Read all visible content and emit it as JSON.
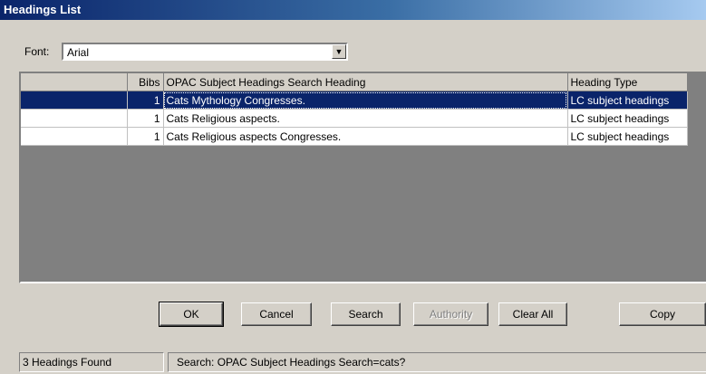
{
  "window": {
    "title": "Headings List"
  },
  "font": {
    "label": "Font:",
    "value": "Arial"
  },
  "grid": {
    "columns": [
      "",
      "Bibs",
      "OPAC Subject Headings Search Heading",
      "Heading Type"
    ],
    "rows": [
      {
        "bibs": "1",
        "heading": "Cats Mythology Congresses.",
        "type": "LC subject headings",
        "selected": true
      },
      {
        "bibs": "1",
        "heading": "Cats Religious aspects.",
        "type": "LC subject headings",
        "selected": false
      },
      {
        "bibs": "1",
        "heading": "Cats Religious aspects Congresses.",
        "type": "LC subject headings",
        "selected": false
      }
    ]
  },
  "buttons": {
    "ok": "OK",
    "cancel": "Cancel",
    "search": "Search",
    "authority": "Authority",
    "clear_all": "Clear All",
    "copy": "Copy"
  },
  "status": {
    "count": "3 Headings Found",
    "search": "Search: OPAC Subject Headings Search=cats?"
  }
}
